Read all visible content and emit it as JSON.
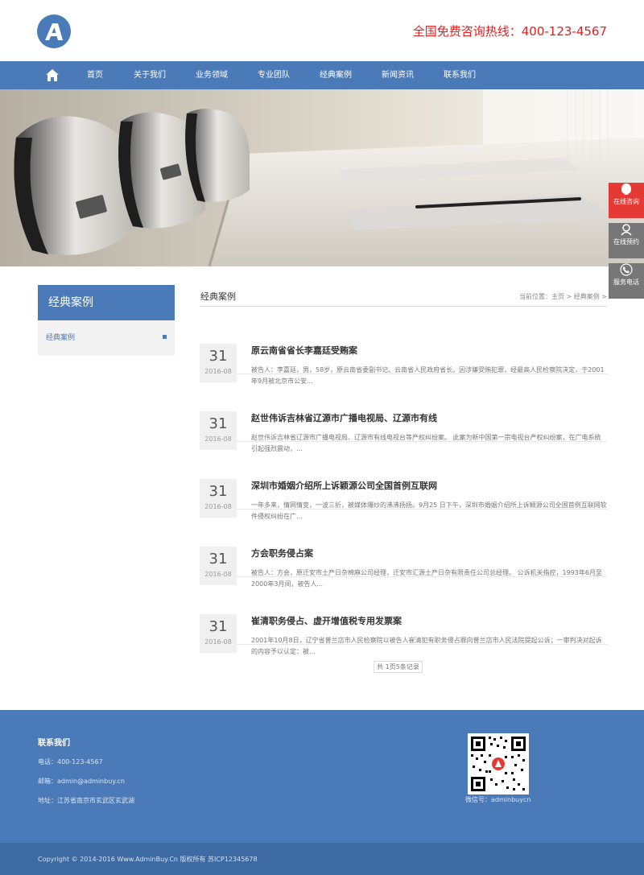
{
  "header": {
    "logo_icon": "letter-a-logo-icon",
    "hotline": "全国免费咨询热线：400-123-4567"
  },
  "nav": {
    "home_icon": "home-icon",
    "items": [
      "首页",
      "关于我们",
      "业务领域",
      "专业团队",
      "经典案例",
      "新闻资讯",
      "联系我们"
    ]
  },
  "side_tools": [
    {
      "icon": "chat-bubble-icon",
      "label": "在线咨询"
    },
    {
      "icon": "user-headset-icon",
      "label": "在线预约"
    },
    {
      "icon": "phone-icon",
      "label": "服务电话"
    }
  ],
  "sidebar": {
    "title": "经典案例",
    "items": [
      "经典案例"
    ]
  },
  "main": {
    "heading": "经典案例",
    "breadcrumb": "当前位置：主页 > 经典案例 >",
    "articles": [
      {
        "day": "31",
        "ym": "2016-08",
        "title": "原云南省省长李嘉廷受贿案",
        "summary": "被告人：李嘉廷，男，58岁，原云南省委副书记、云南省人民政府省长。因涉嫌受贿犯罪，经最高人民检察院决定，于2001年9月被北京市公安..."
      },
      {
        "day": "31",
        "ym": "2016-08",
        "title": "赵世伟诉吉林省辽源市广播电视局、辽源市有线",
        "summary": "赵世伟诉吉林省辽源市广播电视局、辽源市有线电视台等产权纠纷案。 此案为新中国第一宗电视台产权纠纷案，在广电系统引起强烈震动，..."
      },
      {
        "day": "31",
        "ym": "2016-08",
        "title": "深圳市婚姻介绍所上诉颖源公司全国首例互联网",
        "summary": "一年多来，情网情变，一波三折，被媒体爆炒的沸沸扬扬。9月25 日下午，深圳市婚姻介绍所上诉颖源公司全国首例互联网软件侵权纠纷在广..."
      },
      {
        "day": "31",
        "ym": "2016-08",
        "title": "方会职务侵占案",
        "summary": "被告人：方会，原迁安市土产日杂棉麻公司经理，迁安市汇源土产日杂有限责任公司总经理。 公诉机关指控，1993年6月至2000年3月间，被告人..."
      },
      {
        "day": "31",
        "ym": "2016-08",
        "title": "崔清职务侵占、虚开增值税专用发票案",
        "summary": "2001年10月8日，辽宁省普兰店市人民检察院以被告人崔清犯有职务侵占罪向普兰店市人民法院提起公诉；一审判决对起诉的内容予以认定：被..."
      }
    ],
    "pager": "共 1页5条记录"
  },
  "footer": {
    "heading": "联系我们",
    "phone": "电话：400-123-4567",
    "email": "邮箱：admin@adminbuy.cn",
    "address": "地址：江苏省南京市玄武区玄武湖",
    "qr_icon": "qr-code-icon",
    "wechat": "微信号：adminbuycn",
    "copyright": "Copyright © 2014-2016 Www.AdminBuy.Cn 版权所有    苏ICP12345678"
  },
  "colors": {
    "brand": "#4a7ab8",
    "hotline": "#e02020",
    "tool_red": "#e53935",
    "tool_gray": "#777777"
  }
}
